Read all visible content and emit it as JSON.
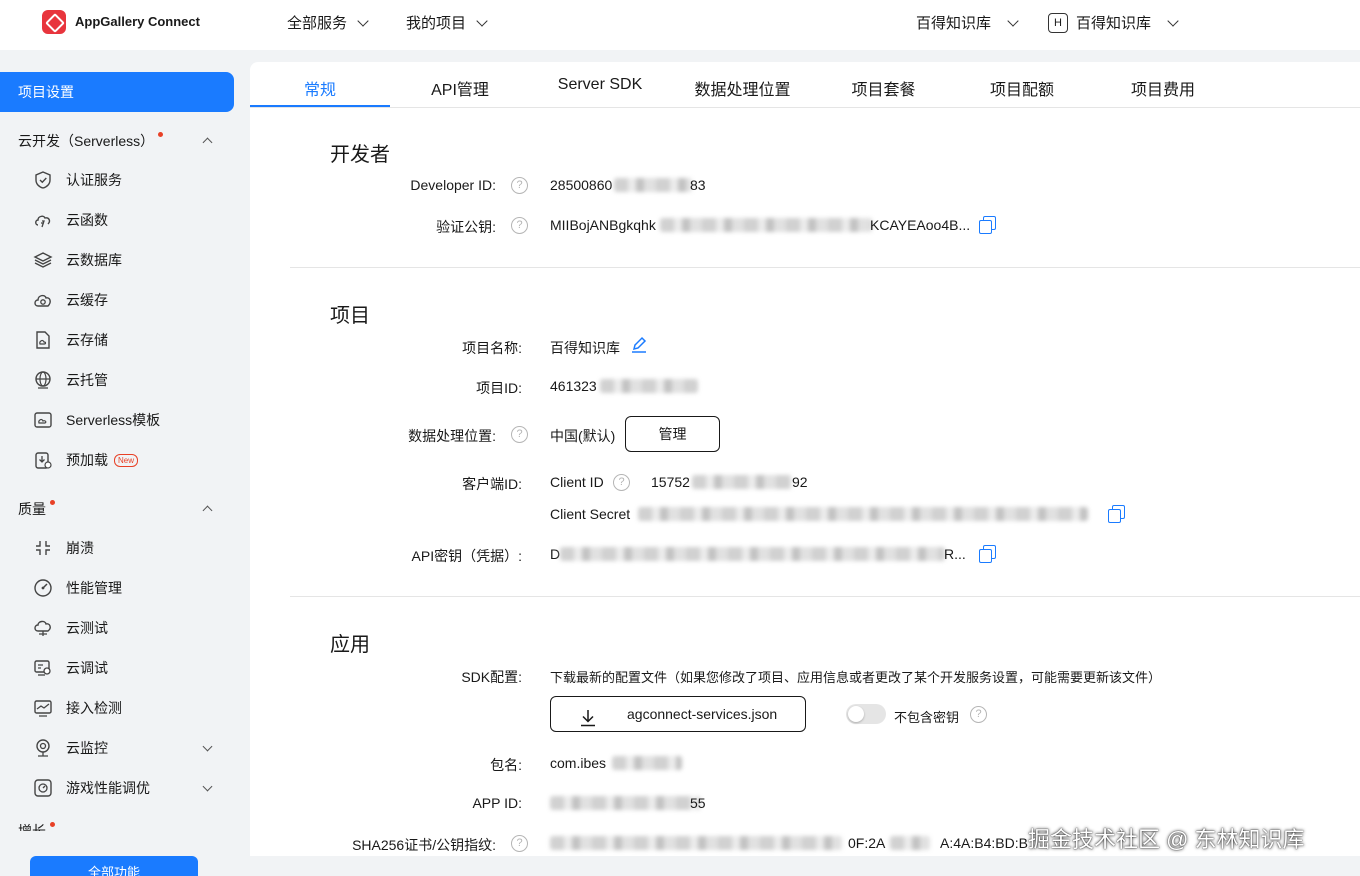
{
  "header": {
    "brand": "AppGallery Connect",
    "nav_all_services": "全部服务",
    "nav_my_projects": "我的项目",
    "team_selector": "百得知识库",
    "account_initial": "H",
    "account_name": "百得知识库"
  },
  "sidebar": {
    "active_item": "项目设置",
    "group_serverless": "云开发（Serverless）",
    "serverless_items": [
      "认证服务",
      "云函数",
      "云数据库",
      "云缓存",
      "云存储",
      "云托管",
      "Serverless模板",
      "预加载"
    ],
    "new_badge": "New",
    "group_quality": "质量",
    "quality_items": [
      "崩溃",
      "性能管理",
      "云测试",
      "云调试",
      "接入检测",
      "云监控",
      "游戏性能调优"
    ],
    "group_partial": "增长",
    "all_functions_button": "全部功能"
  },
  "tabs": [
    "常规",
    "API管理",
    "Server SDK",
    "数据处理位置",
    "项目套餐",
    "项目配额",
    "项目费用"
  ],
  "developer": {
    "section_title": "开发者",
    "developer_id_label": "Developer ID:",
    "developer_id_prefix": "28500860",
    "developer_id_suffix": "83",
    "public_key_label": "验证公钥:",
    "public_key_prefix": "MIIBojANBgkqhk",
    "public_key_suffix": "KCAYEAoo4B..."
  },
  "project": {
    "section_title": "项目",
    "name_label": "项目名称:",
    "name_value": "百得知识库",
    "id_label": "项目ID:",
    "id_prefix": "461323",
    "location_label": "数据处理位置:",
    "location_value": "中国(默认)",
    "manage_button": "管理",
    "client_label": "客户端ID:",
    "client_id_label": "Client ID",
    "client_id_prefix": "15752",
    "client_id_suffix": "92",
    "client_secret_label": "Client Secret",
    "api_key_label": "API密钥（凭据）:",
    "api_key_prefix": "D",
    "api_key_suffix": "R..."
  },
  "app": {
    "section_title": "应用",
    "sdk_label": "SDK配置:",
    "sdk_desc": "下载最新的配置文件（如果您修改了项目、应用信息或者更改了某个开发服务设置，可能需要更新该文件）",
    "download_button": "agconnect-services.json",
    "exclude_key_label": "不包含密钥",
    "package_label": "包名:",
    "package_prefix": "com.ibes",
    "app_id_label": "APP ID:",
    "app_id_suffix": "55",
    "sha_label": "SHA256证书/公钥指纹:",
    "sha_fragment": "0F:2A",
    "sha_fragment2": "A:4A:B4:BD:B"
  },
  "watermark": "掘金技术社区 @ 东林知识库",
  "colors": {
    "accent": "#1a7bff",
    "brand_red": "#e8353d",
    "background": "#f1f3f5"
  }
}
